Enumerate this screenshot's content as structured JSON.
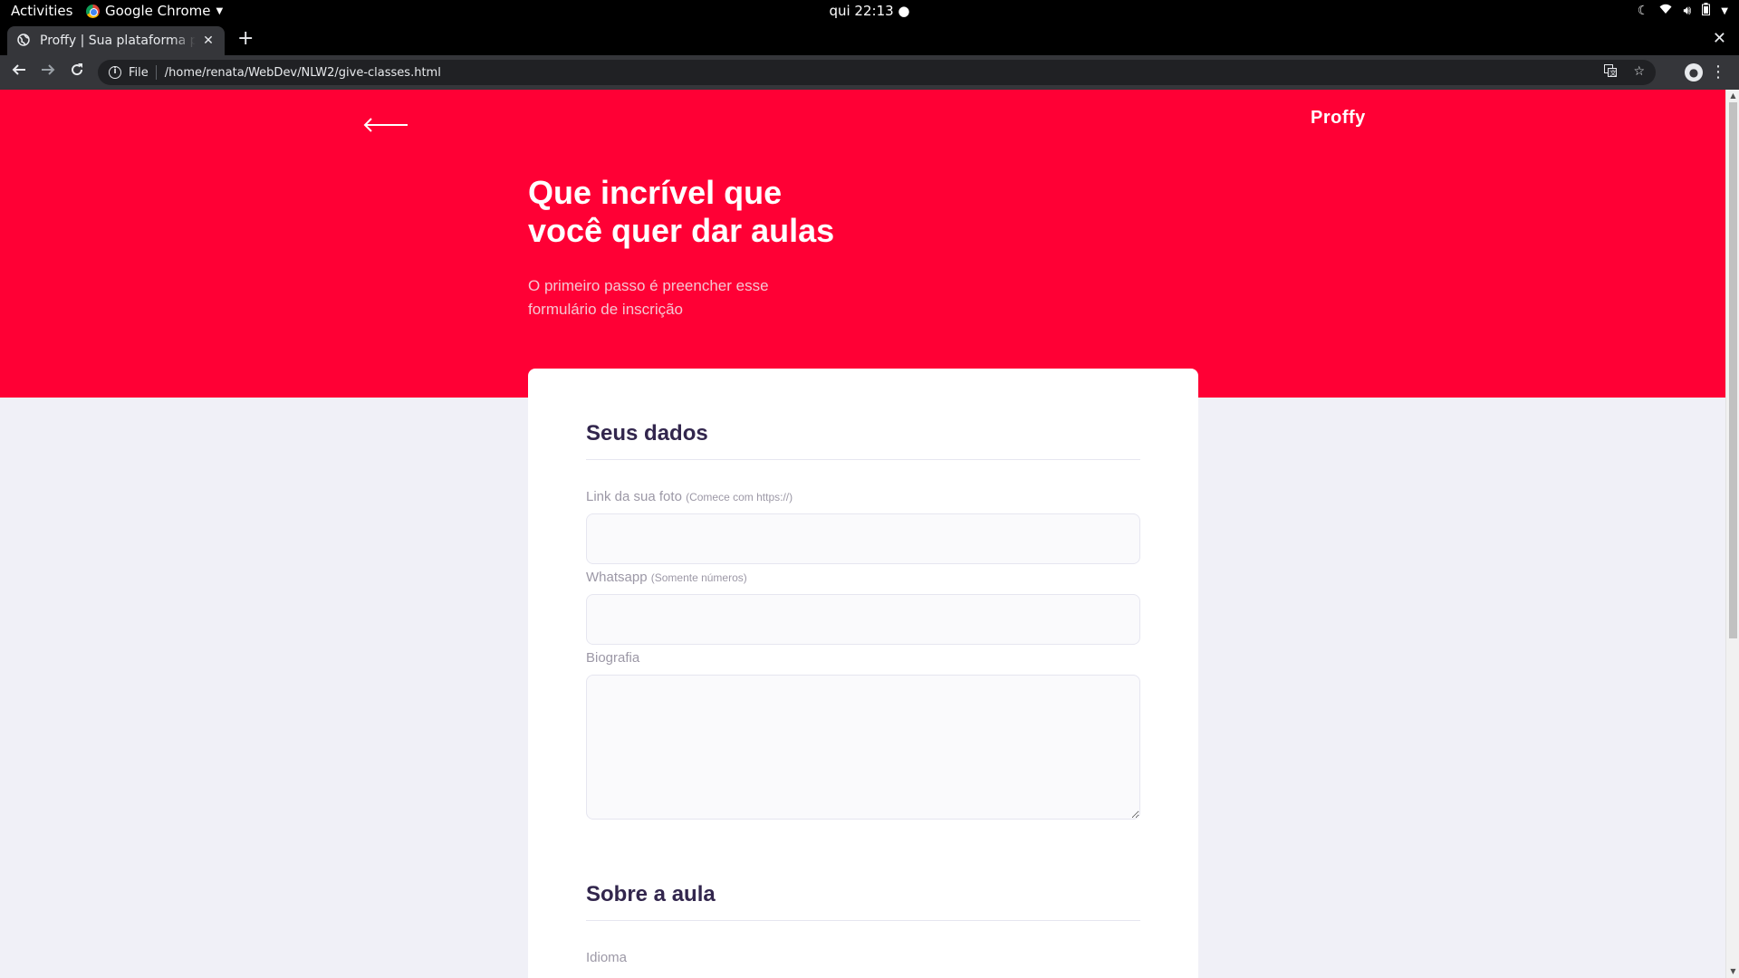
{
  "system_bar": {
    "activities": "Activities",
    "app_name": "Google Chrome",
    "clock": "qui 22:13 ●"
  },
  "browser": {
    "tab_title": "Proffy | Sua plataforma par",
    "scheme_label": "File",
    "url": "/home/renata/WebDev/NLW2/give-classes.html"
  },
  "page": {
    "logo": "Proffy",
    "hero_title_line1": "Que incrível que",
    "hero_title_line2": "você quer dar aulas",
    "hero_sub_line1": "O primeiro passo é preencher esse",
    "hero_sub_line2": "formulário de inscrição",
    "accent_color": "#ff0035",
    "background_color": "#f0f0f7",
    "section1_title": "Seus dados",
    "photo_label": "Link da sua foto",
    "photo_hint": "(Comece com https://)",
    "photo_value": "",
    "whatsapp_label": "Whatsapp",
    "whatsapp_hint": "(Somente números)",
    "whatsapp_value": "",
    "bio_label": "Biografia",
    "bio_value": "",
    "section2_title": "Sobre a aula",
    "subject_label": "Idioma"
  },
  "icons": {
    "back": "arrow-left-icon",
    "reload": "reload-icon",
    "forward": "arrow-right-icon",
    "info": "info-icon",
    "translate": "translate-icon",
    "bookmark": "star-icon",
    "profile": "account-icon",
    "menu": "kebab-menu-icon"
  }
}
